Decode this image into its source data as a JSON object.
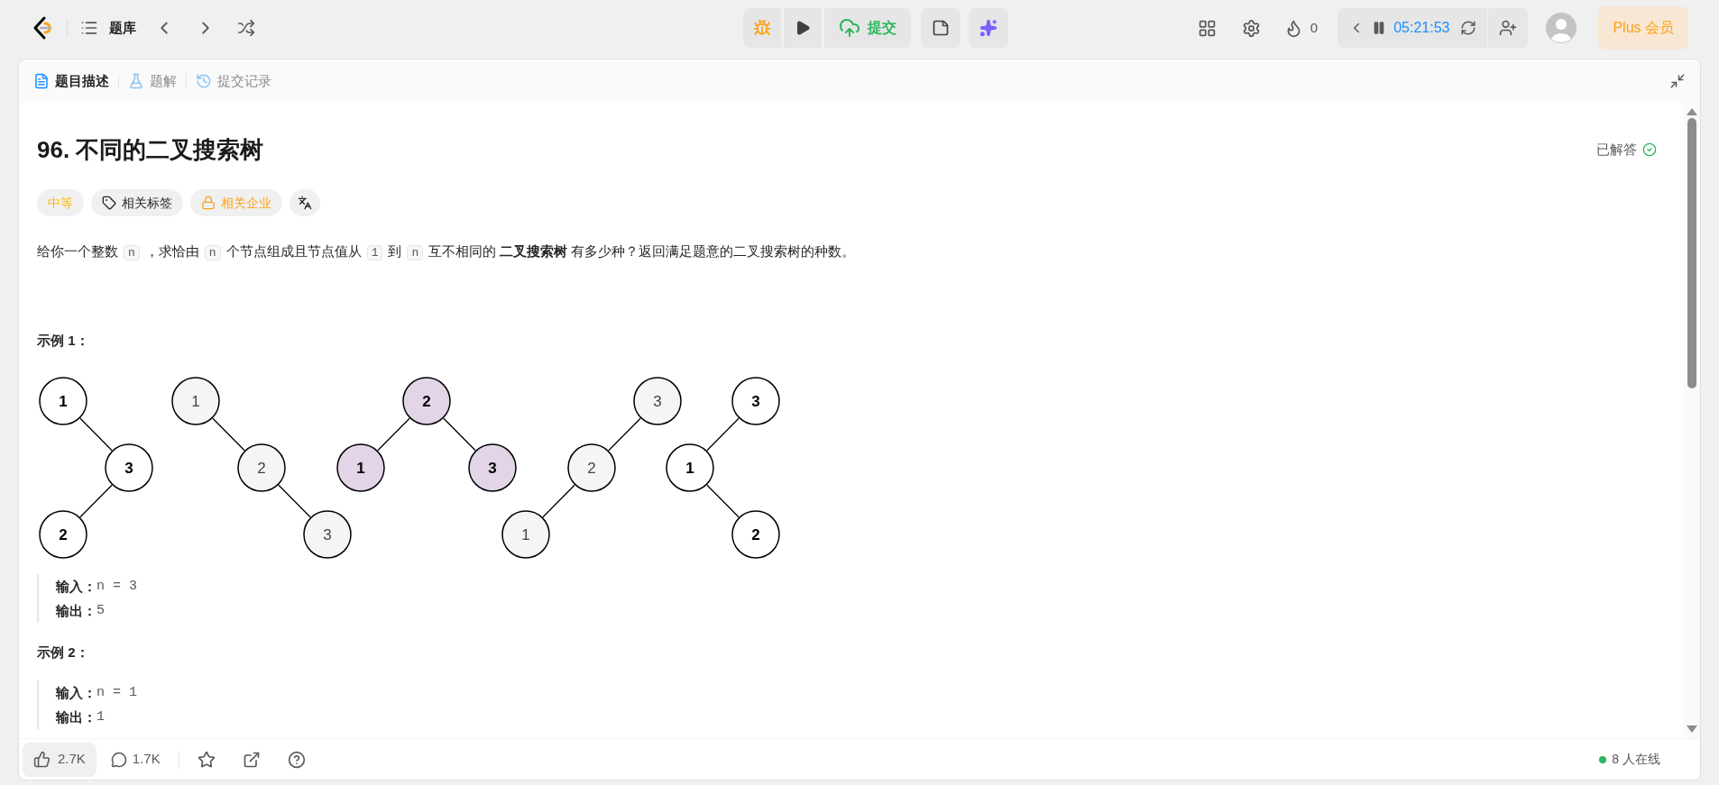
{
  "top_bar": {
    "problem_list": "题库",
    "submit": "提交",
    "streak": "0",
    "timer": "05:21:53",
    "plus": "Plus 会员"
  },
  "tabs": [
    {
      "label": "题目描述",
      "selected": true
    },
    {
      "label": "题解",
      "selected": false
    },
    {
      "label": "提交记录",
      "selected": false
    }
  ],
  "problem": {
    "title": "96. 不同的二叉搜索树",
    "status": "已解答",
    "tags": [
      {
        "label": "中等",
        "kind": "difficulty"
      },
      {
        "label": "相关标签",
        "kind": "topics"
      },
      {
        "label": "相关企业",
        "kind": "companies"
      }
    ],
    "description": [
      {
        "kind": "text",
        "text": "给你一个整数"
      },
      {
        "kind": "code",
        "text": "n"
      },
      {
        "kind": "text",
        "text": "，求恰由"
      },
      {
        "kind": "code",
        "text": "n"
      },
      {
        "kind": "text",
        "text": "个节点组成且节点值从"
      },
      {
        "kind": "code",
        "text": "1"
      },
      {
        "kind": "text",
        "text": "到"
      },
      {
        "kind": "code",
        "text": "n"
      },
      {
        "kind": "text",
        "text": "互不相同的"
      },
      {
        "kind": "bold",
        "text": "二叉搜索树"
      },
      {
        "kind": "text",
        "text": "有多少种？返回满足题意的二叉搜索树的种数。"
      }
    ],
    "examples": [
      {
        "heading": "示例 1：",
        "trees": [
          {
            "color": "#ffffff",
            "root": {
              "label": "1",
              "right": {
                "label": "3",
                "left": {
                  "label": "2"
                }
              }
            }
          },
          {
            "color": "#f5f5f5",
            "root": {
              "label": "1",
              "right": {
                "label": "2",
                "right": {
                  "label": "3"
                }
              }
            }
          },
          {
            "color": "#e1d5e7",
            "root": {
              "label": "2",
              "left": {
                "label": "1"
              },
              "right": {
                "label": "3"
              }
            }
          },
          {
            "color": "#f5f5f5",
            "root": {
              "label": "3",
              "left": {
                "label": "2",
                "left": {
                  "label": "1"
                }
              }
            }
          },
          {
            "color": "#ffffff",
            "root": {
              "label": "3",
              "left": {
                "label": "1",
                "right": {
                  "label": "2"
                }
              }
            }
          }
        ],
        "input_label": "输入：",
        "input": "n = 3",
        "output_label": "输出：",
        "output": "5"
      },
      {
        "heading": "示例 2：",
        "input_label": "输入：",
        "input": "n = 1",
        "output_label": "输出：",
        "output": "1"
      }
    ]
  },
  "footer": {
    "likes": "2.7K",
    "comments": "1.7K",
    "online": "8 人在线"
  }
}
